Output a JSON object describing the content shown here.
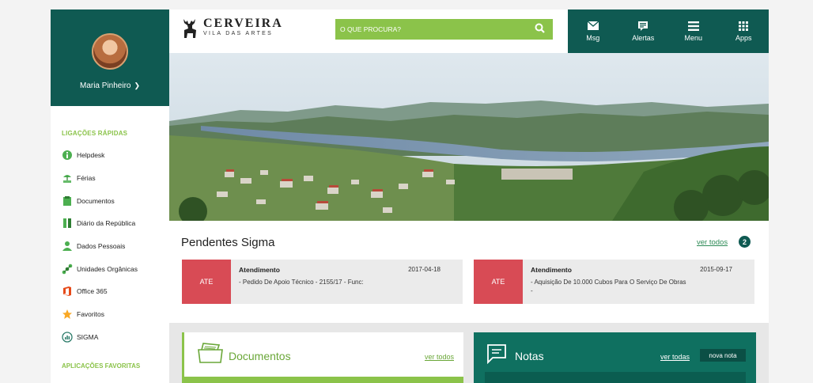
{
  "user": {
    "name": "Maria Pinheiro"
  },
  "header": {
    "logo_title": "CERVEIRA",
    "logo_subtitle": "VILA DAS ARTES",
    "search_placeholder": "O QUE PROCURA?",
    "nav": [
      {
        "label": "Msg",
        "icon": "mail-icon"
      },
      {
        "label": "Alertas",
        "icon": "alert-icon"
      },
      {
        "label": "Menu",
        "icon": "menu-icon"
      },
      {
        "label": "Apps",
        "icon": "apps-icon"
      }
    ]
  },
  "sidebar": {
    "quick_title": "LIGAÇÕES RÁPIDAS",
    "items": [
      {
        "label": "Helpdesk",
        "icon": "info-icon",
        "color": "#4caf50"
      },
      {
        "label": "Férias",
        "icon": "holiday-icon",
        "color": "#4caf50"
      },
      {
        "label": "Documentos",
        "icon": "folder-icon",
        "color": "#4caf50"
      },
      {
        "label": "Diário da República",
        "icon": "book-icon",
        "color": "#4caf50"
      },
      {
        "label": "Dados Pessoais",
        "icon": "person-icon",
        "color": "#4caf50"
      },
      {
        "label": "Unidades Orgânicas",
        "icon": "org-icon",
        "color": "#4caf50"
      },
      {
        "label": "Office 365",
        "icon": "office-icon",
        "color": "#e64a19"
      },
      {
        "label": "Favoritos",
        "icon": "star-icon",
        "color": "#f9a825"
      },
      {
        "label": "SIGMA",
        "icon": "sigma-icon",
        "color": "#2e7d6b"
      }
    ],
    "favorites_title": "APLICAÇÕES FAVORITAS"
  },
  "pendentes": {
    "title": "Pendentes Sigma",
    "see_all": "ver todos",
    "count": "2",
    "cards": [
      {
        "tag": "ATE",
        "title": "Atendimento",
        "date": "2017-04-18",
        "desc": "- Pedido De Apoio Técnico - 2155/17 - Func:"
      },
      {
        "tag": "ATE",
        "title": "Atendimento",
        "date": "2015-09-17",
        "desc": "- Aquisição De 10.000 Cubos Para O Serviço De Obras -"
      }
    ]
  },
  "documentos": {
    "title": "Documentos",
    "see_all": "ver todos"
  },
  "notas": {
    "title": "Notas",
    "see_all": "ver todas",
    "new_label": "nova nota"
  },
  "colors": {
    "primary": "#0f5a52",
    "accent": "#8bc34a",
    "tag": "#d84b55"
  }
}
